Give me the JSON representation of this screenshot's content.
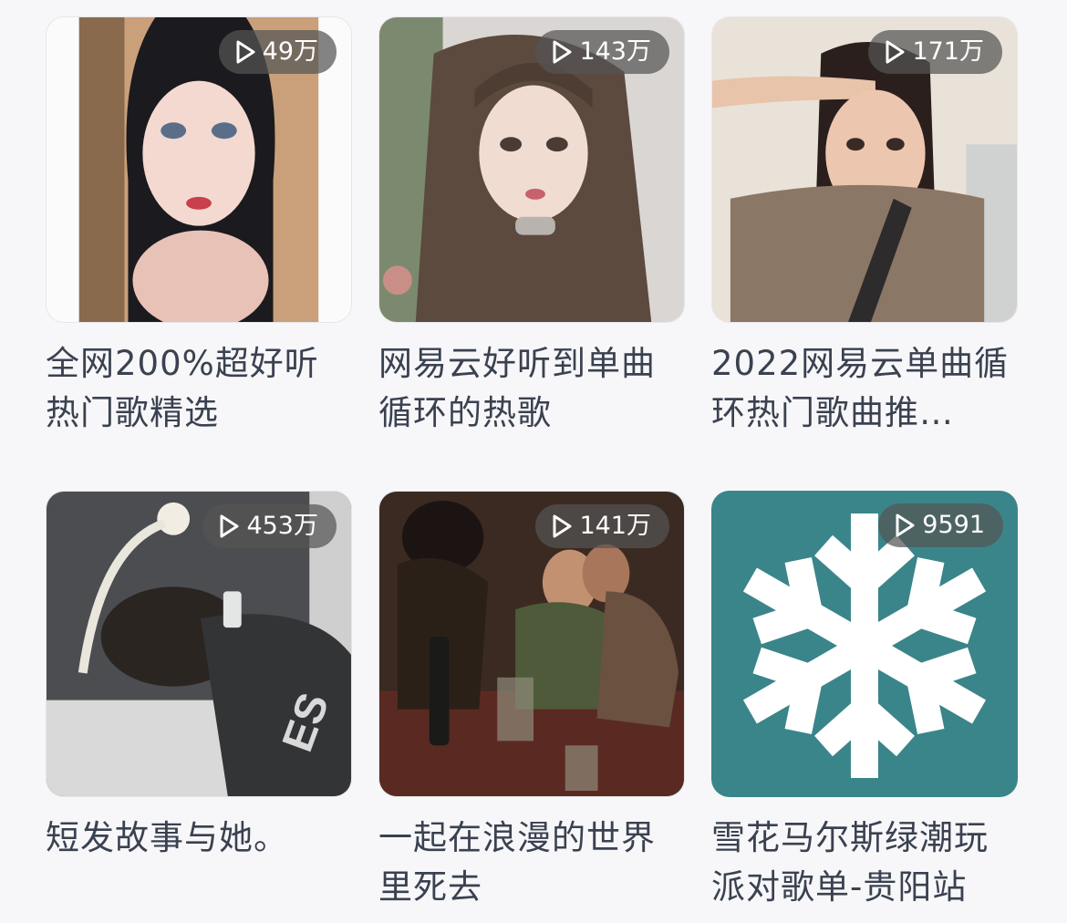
{
  "playlists": [
    {
      "title": "全网200%超好听热门歌精选",
      "play_count": "49万",
      "cover_icon": "portrait-photo"
    },
    {
      "title": "网易云好听到单曲循环的热歌",
      "play_count": "143万",
      "cover_icon": "portrait-photo"
    },
    {
      "title": "2022网易云单曲循环热门歌曲推…",
      "play_count": "171万",
      "cover_icon": "portrait-photo"
    },
    {
      "title": "短发故事与她。",
      "play_count": "453万",
      "cover_icon": "sleeping-person-photo"
    },
    {
      "title": "一起在浪漫的世界里死去",
      "play_count": "141万",
      "cover_icon": "painting-couple"
    },
    {
      "title": "雪花马尔斯绿潮玩派对歌单-贵阳站",
      "play_count": "9591",
      "cover_icon": "snowflake-icon"
    }
  ],
  "colors": {
    "background": "#f7f7f9",
    "title_text": "#3a4150",
    "badge_bg": "#555555b8",
    "snowflake_teal": "#3a8589"
  }
}
